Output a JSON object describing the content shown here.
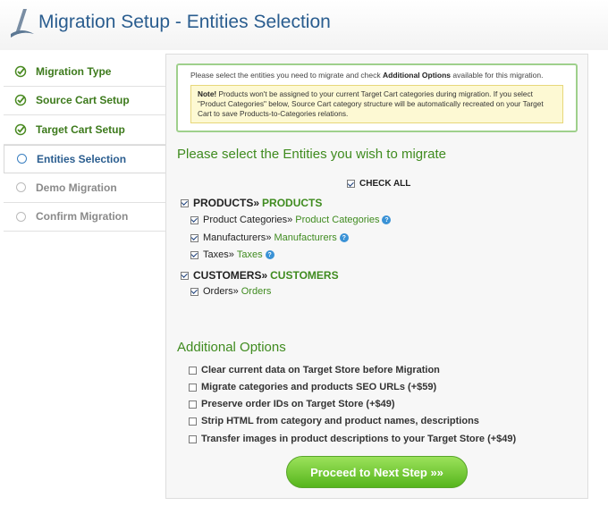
{
  "header": {
    "title": "Migration Setup - Entities Selection"
  },
  "sidebar": {
    "steps": [
      {
        "label": "Migration Type",
        "state": "done"
      },
      {
        "label": "Source Cart Setup",
        "state": "done"
      },
      {
        "label": "Target Cart Setup",
        "state": "done"
      },
      {
        "label": "Entities Selection",
        "state": "active"
      },
      {
        "label": "Demo Migration",
        "state": "pending"
      },
      {
        "label": "Confirm Migration",
        "state": "pending"
      }
    ]
  },
  "info": {
    "text_pre": "Please select the entities you need to migrate and check ",
    "text_bold": "Additional Options",
    "text_post": " available for this migration.",
    "note_bold": "Note!",
    "note_text": " Products won't be assigned to your current Target Cart categories during migration. If you select \"Product Categories\" below, Source Cart category structure will be automatically recreated on your Target Cart to save Products-to-Categories relations."
  },
  "entities": {
    "heading": "Please select the Entities you wish to migrate",
    "check_all_label": "CHECK ALL",
    "groups": [
      {
        "source": "PRODUCTS",
        "sep": " »",
        "target": "PRODUCTS",
        "checked": true,
        "children": [
          {
            "source": "Product Categories",
            "sep": " »",
            "target": "Product Categories",
            "checked": true,
            "help": "?"
          },
          {
            "source": "Manufacturers",
            "sep": " »",
            "target": "Manufacturers",
            "checked": true,
            "help": "?"
          },
          {
            "source": "Taxes",
            "sep": " »",
            "target": "Taxes",
            "checked": true,
            "help": "?"
          }
        ]
      },
      {
        "source": "CUSTOMERS",
        "sep": " »",
        "target": "CUSTOMERS",
        "checked": true,
        "children": [
          {
            "source": "Orders",
            "sep": " »",
            "target": "Orders",
            "checked": true
          }
        ]
      }
    ]
  },
  "options": {
    "heading": "Additional Options",
    "items": [
      {
        "label": "Clear current data on Target Store before Migration",
        "checked": false
      },
      {
        "label": "Migrate categories and products SEO URLs (+$59)",
        "checked": false
      },
      {
        "label": "Preserve order IDs on Target Store (+$49)",
        "checked": false
      },
      {
        "label": "Strip HTML from category and product names, descriptions",
        "checked": false
      },
      {
        "label": "Transfer images in product descriptions to your Target Store (+$49)",
        "checked": false
      }
    ]
  },
  "actions": {
    "proceed_label": "Proceed to Next Step »»"
  },
  "colors": {
    "title_blue": "#2a5d8f",
    "green": "#3f8b1f",
    "button_green": "#56b51c"
  }
}
